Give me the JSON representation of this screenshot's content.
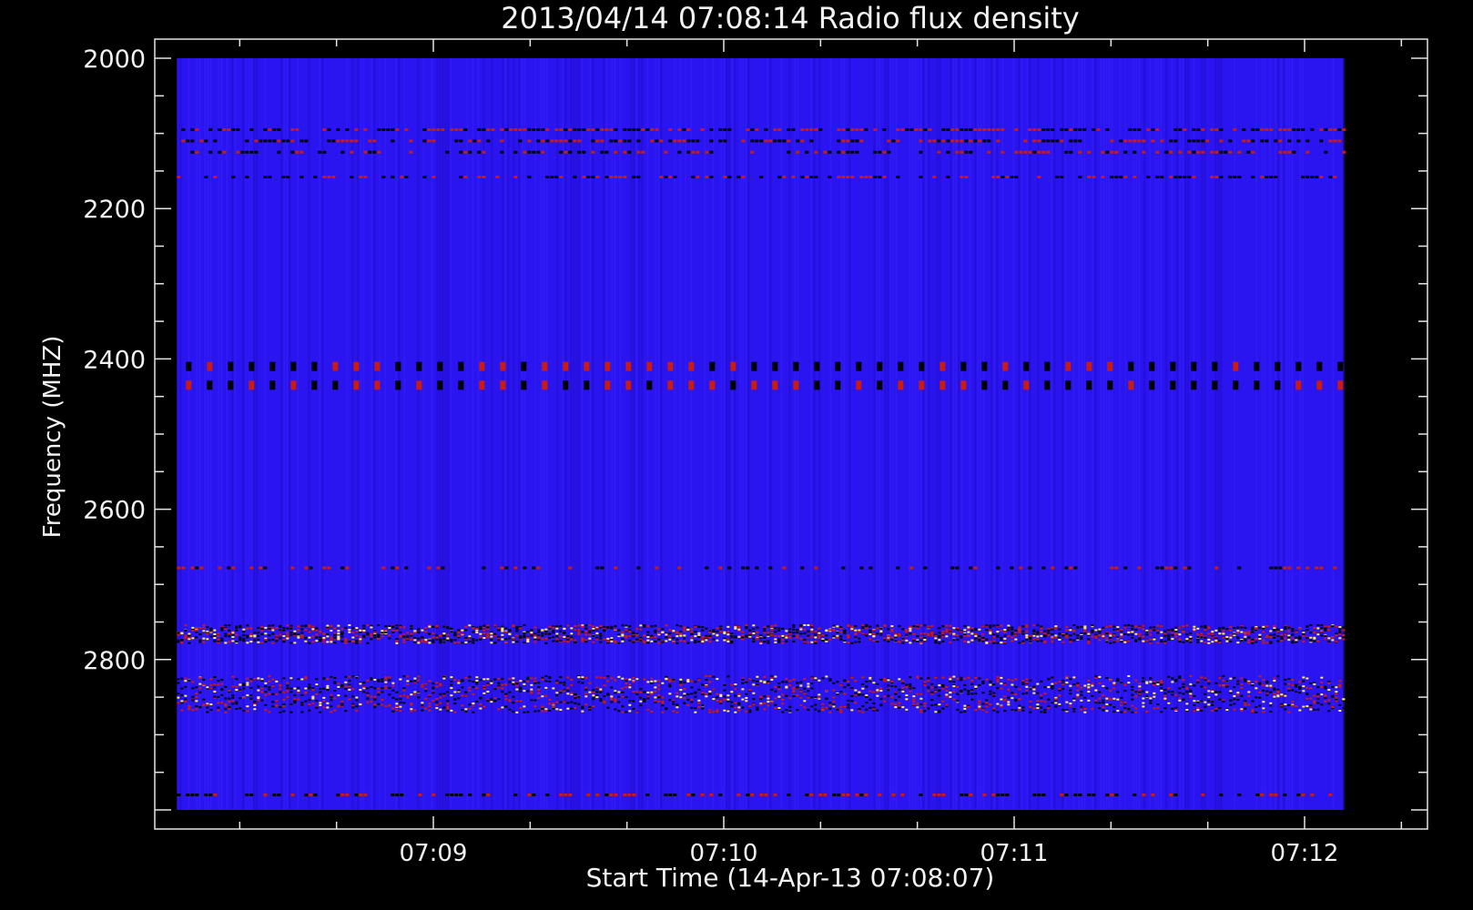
{
  "chart_data": {
    "type": "heatmap",
    "title": "2013/04/14 07:08:14 Radio flux density",
    "xlabel": "Start Time (14-Apr-13 07:08:07)",
    "ylabel": "Frequency (MHZ)",
    "x_tick_labels": [
      "07:09",
      "07:10",
      "07:11",
      "07:12"
    ],
    "x_tick_times_min": [
      9,
      10,
      11,
      12
    ],
    "x_range_min": [
      7.8,
      12.2
    ],
    "y_tick_labels": [
      "2000",
      "2200",
      "2400",
      "2600",
      "2800"
    ],
    "y_tick_values": [
      2000,
      2200,
      2400,
      2600,
      2800
    ],
    "y_range": [
      2000,
      3000
    ],
    "y_inverted": true,
    "data_time_range_min": [
      8.117,
      12.133
    ],
    "data_freq_range": [
      2000,
      3000
    ],
    "background_color": "#2a14f0",
    "colormap": [
      "#000000",
      "#2a14f0",
      "#cc1a10",
      "#ffea60"
    ],
    "bands": [
      {
        "freq": 2095,
        "intensity": 0.7,
        "kind": "interference"
      },
      {
        "freq": 2110,
        "intensity": 0.6,
        "kind": "interference"
      },
      {
        "freq": 2125,
        "intensity": 0.5,
        "kind": "interference"
      },
      {
        "freq": 2158,
        "intensity": 0.5,
        "kind": "interference"
      },
      {
        "freq": 2410,
        "intensity": 0.9,
        "kind": "pulsed"
      },
      {
        "freq": 2435,
        "intensity": 0.8,
        "kind": "pulsed"
      },
      {
        "freq": 2678,
        "intensity": 0.4,
        "kind": "interference"
      },
      {
        "freq": 2765,
        "intensity": 0.8,
        "kind": "strong"
      },
      {
        "freq": 2845,
        "intensity": 1.0,
        "kind": "strong"
      },
      {
        "freq": 2980,
        "intensity": 0.5,
        "kind": "interference"
      }
    ]
  }
}
